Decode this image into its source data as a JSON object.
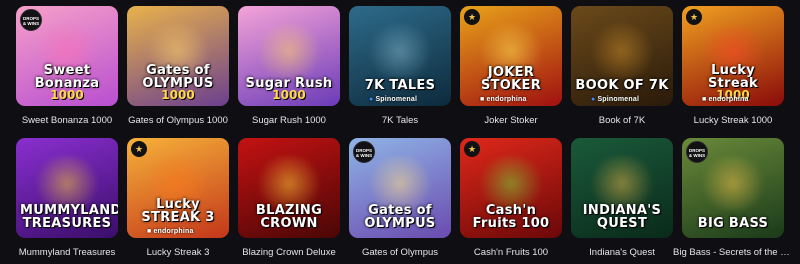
{
  "games_row_1": [
    {
      "title": "Sweet Bonanza 1000",
      "logo_line1": "Sweet Bonanza",
      "logo_line2": "1000",
      "provider": "",
      "badge": "drops",
      "badge_text": [
        "DROPS",
        "& WINS"
      ],
      "bg_top": "#f7a0c9",
      "bg_bottom": "#b84fd0",
      "glow": "#ff6fb1"
    },
    {
      "title": "Gates of Olympus 1000",
      "logo_line1": "Gates of OLYMPUS",
      "logo_line2": "1000",
      "provider": "",
      "badge": "",
      "badge_text": [],
      "bg_top": "#e9b24a",
      "bg_bottom": "#6b3f8f",
      "glow": "#ffd36a"
    },
    {
      "title": "Sugar Rush 1000",
      "logo_line1": "Sugar Rush",
      "logo_line2": "1000",
      "provider": "",
      "badge": "",
      "badge_text": [],
      "bg_top": "#f5a3d8",
      "bg_bottom": "#6a3bb8",
      "glow": "#ffd166"
    },
    {
      "title": "7K Tales",
      "logo_line1": "7K TALES",
      "logo_line2": "",
      "provider": "Spinomenal",
      "provider_kind": "spin",
      "badge": "",
      "badge_text": [],
      "bg_top": "#2d6b8a",
      "bg_bottom": "#0e2a3c",
      "glow": "#7fb3c9"
    },
    {
      "title": "Joker Stoker",
      "logo_line1": "JOKER STOKER",
      "logo_line2": "",
      "provider": "endorphina",
      "provider_kind": "endo",
      "badge": "trophy",
      "badge_text": [],
      "bg_top": "#e8a21a",
      "bg_bottom": "#a01010",
      "glow": "#ffdd55"
    },
    {
      "title": "Book of 7K",
      "logo_line1": "BOOK OF 7K",
      "logo_line2": "",
      "provider": "Spinomenal",
      "provider_kind": "spin",
      "badge": "",
      "badge_text": [],
      "bg_top": "#6b4a1a",
      "bg_bottom": "#2a1a0a",
      "glow": "#c98b2a"
    },
    {
      "title": "Lucky Streak 1000",
      "logo_line1": "Lucky Streak",
      "logo_line2": "1000",
      "provider": "endorphina",
      "provider_kind": "endo",
      "badge": "trophy",
      "badge_text": [],
      "bg_top": "#f0a020",
      "bg_bottom": "#8a0a0a",
      "glow": "#ff4a2a"
    }
  ],
  "games_row_2": [
    {
      "title": "Mummyland Treasures",
      "logo_line1": "MUMMYLAND TREASURES",
      "logo_line2": "",
      "provider": "",
      "badge": "",
      "badge_text": [],
      "bg_top": "#8a2fd0",
      "bg_bottom": "#3a0e6a",
      "glow": "#f2c63a"
    },
    {
      "title": "Lucky Streak 3",
      "logo_line1": "Lucky STREAK 3",
      "logo_line2": "",
      "provider": "endorphina",
      "provider_kind": "endo",
      "badge": "trophy",
      "badge_text": [],
      "bg_top": "#f6b23a",
      "bg_bottom": "#c4361a",
      "glow": "#ff7a1a"
    },
    {
      "title": "Blazing Crown Deluxe",
      "logo_line1": "BLAZING CROWN",
      "logo_line2": "",
      "provider": "",
      "badge": "",
      "badge_text": [],
      "bg_top": "#c41212",
      "bg_bottom": "#4a0606",
      "glow": "#ffcf3a"
    },
    {
      "title": "Gates of Olympus",
      "logo_line1": "Gates of OLYMPUS",
      "logo_line2": "",
      "provider": "",
      "badge": "drops",
      "badge_text": [
        "DROPS",
        "& WINS"
      ],
      "bg_top": "#8fb4e6",
      "bg_bottom": "#6a4bb0",
      "glow": "#ffe08a"
    },
    {
      "title": "Cash'n Fruits 100",
      "logo_line1": "Cash'n Fruits 100",
      "logo_line2": "",
      "provider": "",
      "badge": "trophy",
      "badge_text": [],
      "bg_top": "#e0281a",
      "bg_bottom": "#6a0808",
      "glow": "#7ad83a"
    },
    {
      "title": "Indiana's Quest",
      "logo_line1": "INDIANA'S QUEST",
      "logo_line2": "",
      "provider": "",
      "badge": "",
      "badge_text": [],
      "bg_top": "#1a5a3a",
      "bg_bottom": "#0a2a1a",
      "glow": "#e0b24a"
    },
    {
      "title": "Big Bass - Secrets of the Golden Lake",
      "logo_line1": "BIG BASS",
      "logo_line2": "",
      "provider": "",
      "badge": "drops",
      "badge_text": [
        "DROPS",
        "& WINS"
      ],
      "bg_top": "#6a8a3a",
      "bg_bottom": "#1a3a1a",
      "glow": "#f0c04a"
    }
  ]
}
